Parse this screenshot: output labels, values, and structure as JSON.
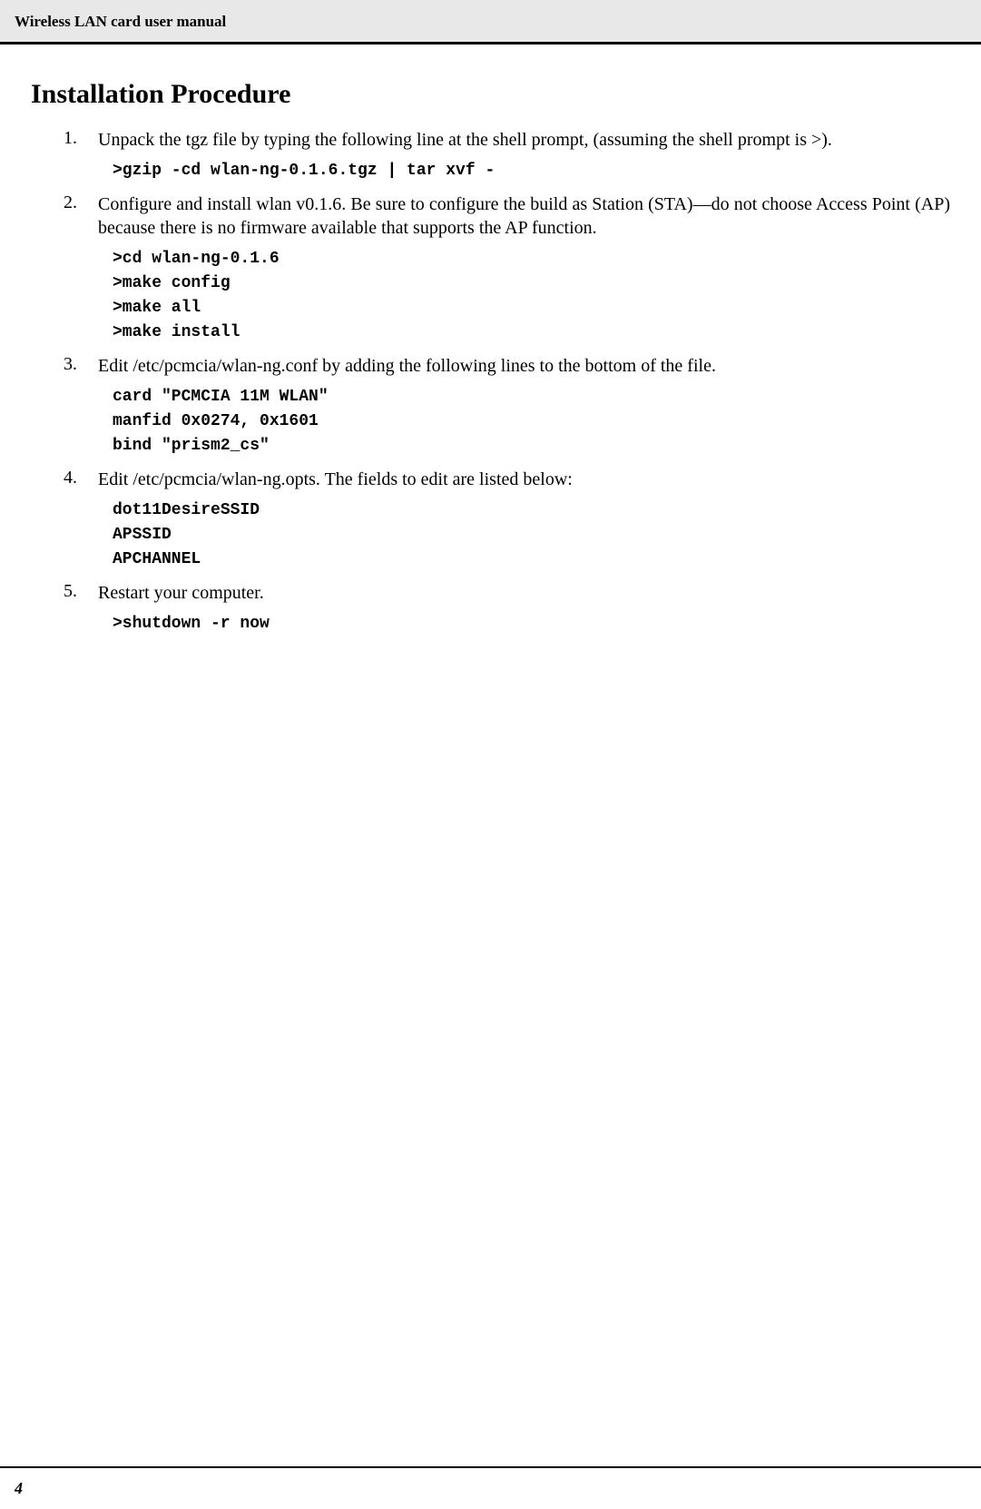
{
  "header": {
    "title": "Wireless LAN card user manual"
  },
  "heading": "Installation Procedure",
  "steps": [
    {
      "num": "1.",
      "text": "Unpack the tgz file by typing the following line at the shell prompt, (assuming the shell prompt is >).",
      "code": ">gzip -cd wlan-ng-0.1.6.tgz | tar xvf -"
    },
    {
      "num": "2.",
      "text": "Configure and install wlan v0.1.6. Be sure to configure the build as Station (STA)—do not choose Access Point (AP) because there is no firmware available that supports the AP function.",
      "code": ">cd wlan-ng-0.1.6\n>make config\n>make all\n>make install"
    },
    {
      "num": "3.",
      "text": "Edit /etc/pcmcia/wlan-ng.conf by adding the following lines to the bottom of the file.",
      "code": "card \"PCMCIA 11M WLAN\"\nmanfid 0x0274, 0x1601\nbind \"prism2_cs\""
    },
    {
      "num": "4.",
      "text": "Edit /etc/pcmcia/wlan-ng.opts. The fields to edit are listed below:",
      "code": "dot11DesireSSID\nAPSSID\nAPCHANNEL"
    },
    {
      "num": "5.",
      "text": "Restart your computer.",
      "code": ">shutdown -r now"
    }
  ],
  "page_number": "4"
}
